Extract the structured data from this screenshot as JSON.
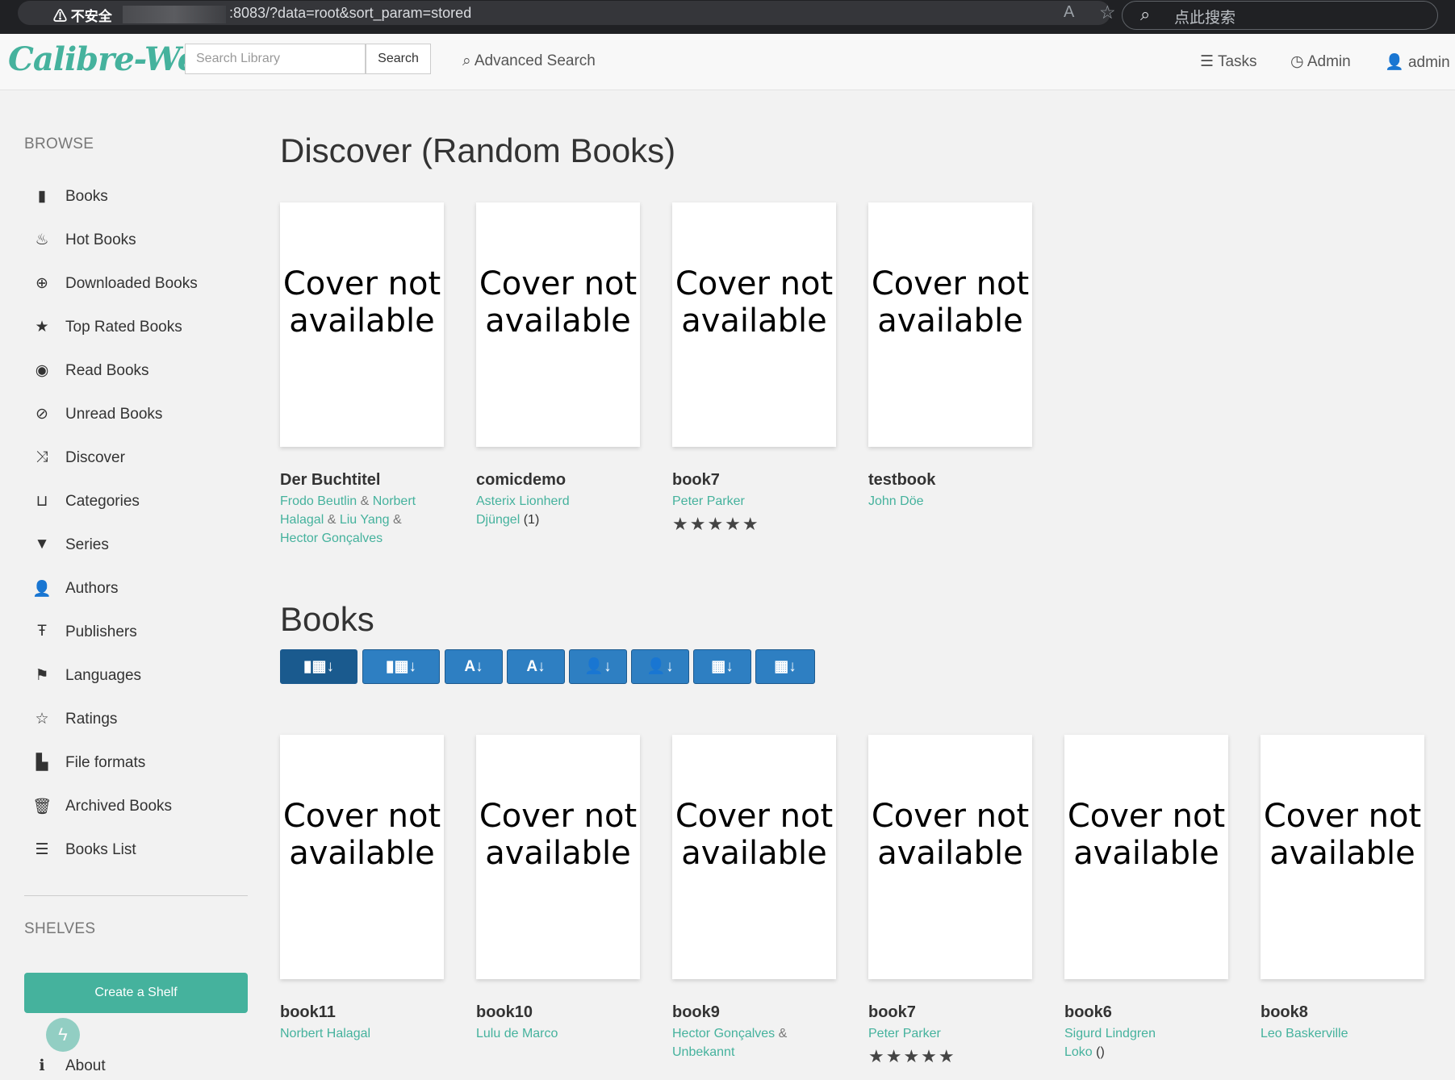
{
  "browser": {
    "security_label": "不安全",
    "url_suffix": ":8083/?data=root&sort_param=stored",
    "search_placeholder": "点此搜索"
  },
  "navbar": {
    "logo": "Calibre-Web",
    "search_placeholder": "Search Library",
    "search_button": "Search",
    "advanced_search": "Advanced Search",
    "tasks": "Tasks",
    "admin": "Admin",
    "user": "admin"
  },
  "sidebar": {
    "browse_heading": "BROWSE",
    "items": [
      {
        "label": "Books",
        "icon": "book-icon"
      },
      {
        "label": "Hot Books",
        "icon": "fire-icon"
      },
      {
        "label": "Downloaded Books",
        "icon": "download-icon"
      },
      {
        "label": "Top Rated Books",
        "icon": "star-icon"
      },
      {
        "label": "Read Books",
        "icon": "eye-icon"
      },
      {
        "label": "Unread Books",
        "icon": "eye-slash-icon"
      },
      {
        "label": "Discover",
        "icon": "shuffle-icon"
      },
      {
        "label": "Categories",
        "icon": "inbox-icon"
      },
      {
        "label": "Series",
        "icon": "bookmark-icon"
      },
      {
        "label": "Authors",
        "icon": "user-icon"
      },
      {
        "label": "Publishers",
        "icon": "text-size-icon"
      },
      {
        "label": "Languages",
        "icon": "flag-icon"
      },
      {
        "label": "Ratings",
        "icon": "star-empty-icon"
      },
      {
        "label": "File formats",
        "icon": "file-icon"
      },
      {
        "label": "Archived Books",
        "icon": "trash-icon"
      },
      {
        "label": "Books List",
        "icon": "list-icon"
      }
    ],
    "shelves_heading": "SHELVES",
    "create_shelf": "Create a Shelf",
    "about": "About"
  },
  "discover": {
    "heading": "Discover (Random Books)",
    "cover_text": "Cover not available",
    "books": [
      {
        "title": "Der Buchtitel",
        "authors_line1": "Frodo Beutlin",
        "amp": "&",
        "authors_line2": "Norbert",
        "authors_line3": "Halagal",
        "authors_line4": "Liu Yang",
        "authors_line5": "Hector Gonçalves"
      },
      {
        "title": "comicdemo",
        "author1": "Asterix Lionherd",
        "author2": "Djüngel",
        "series": "(1)"
      },
      {
        "title": "book7",
        "author1": "Peter Parker",
        "rating": 5
      },
      {
        "title": "testbook",
        "author1": "John Döe"
      }
    ]
  },
  "books_section": {
    "heading": "Books",
    "sort_buttons": [
      {
        "glyph": "▮▦↓",
        "active": true
      },
      {
        "glyph": "▮▦↓",
        "active": false
      },
      {
        "glyph": "A↓",
        "active": false
      },
      {
        "glyph": "A↓",
        "active": false
      },
      {
        "glyph": "👤↓",
        "active": false
      },
      {
        "glyph": "👤↓",
        "active": false
      },
      {
        "glyph": "▦↓",
        "active": false
      },
      {
        "glyph": "▦↓",
        "active": false
      }
    ],
    "books": [
      {
        "title": "book11",
        "author1": "Norbert Halagal"
      },
      {
        "title": "book10",
        "author1": "Lulu de Marco"
      },
      {
        "title": "book9",
        "author1": "Hector Gonçalves",
        "author2": "Unbekannt"
      },
      {
        "title": "book7",
        "author1": "Peter Parker",
        "rating": 5
      },
      {
        "title": "book6",
        "author1": "Sigurd Lindgren",
        "author2": "Loko",
        "series": "()"
      },
      {
        "title": "book8",
        "author1": "Leo Baskerville"
      }
    ]
  },
  "colors": {
    "accent": "#45b29d",
    "primary_button": "#2e7fc2"
  }
}
